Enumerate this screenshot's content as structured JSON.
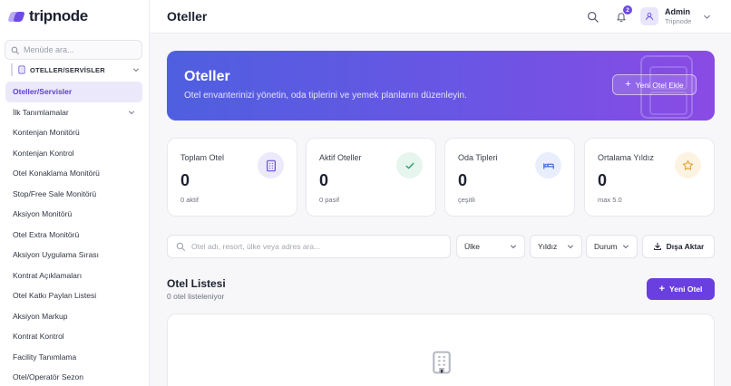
{
  "app": {
    "logo_text": "tripnode"
  },
  "sidebar": {
    "search_placeholder": "Menüde ara...",
    "section_label": "OTELLER/SERVİSLER",
    "items": [
      {
        "label": "Oteller/Servisler",
        "active": true
      },
      {
        "label": "İlk Tanımlamalar",
        "has_chevron": true
      },
      {
        "label": "Kontenjan Monitörü"
      },
      {
        "label": "Kontenjan Kontrol"
      },
      {
        "label": "Otel Konaklama Monitörü"
      },
      {
        "label": "Stop/Free Sale Monitörü"
      },
      {
        "label": "Aksiyon Monitörü"
      },
      {
        "label": "Otel Extra Monitörü"
      },
      {
        "label": "Aksiyon Uygulama Sırası"
      },
      {
        "label": "Kontrat Açıklamaları"
      },
      {
        "label": "Otel Katkı Paylan Listesi"
      },
      {
        "label": "Aksiyon Markup"
      },
      {
        "label": "Kontrat Kontrol"
      },
      {
        "label": "Facility Tanımlama"
      },
      {
        "label": "Otel/Operatör Sezon"
      }
    ]
  },
  "header": {
    "title": "Oteller",
    "notification_count": "2",
    "user": {
      "name": "Admin",
      "org": "Tripnode"
    }
  },
  "hero": {
    "title": "Oteller",
    "subtitle": "Otel envanterinizi yönetin, oda tiplerini ve yemek planlarını düzenleyin.",
    "button_label": "Yeni Otel Ekle"
  },
  "stats": [
    {
      "label": "Toplam Otel",
      "value": "0",
      "sub": "0 aktif",
      "icon": "building-icon",
      "icon_bg": "#ece9fb",
      "icon_color": "#6a4fe0"
    },
    {
      "label": "Aktif Oteller",
      "value": "0",
      "sub": "0 pasif",
      "icon": "check-icon",
      "icon_bg": "#e6f6ee",
      "icon_color": "#22a06b"
    },
    {
      "label": "Oda Tipleri",
      "value": "0",
      "sub": "çeşitli",
      "icon": "bed-icon",
      "icon_bg": "#e8eefc",
      "icon_color": "#4a6fe0"
    },
    {
      "label": "Ortalama Yıldız",
      "value": "0",
      "sub": "max 5.0",
      "icon": "star-icon",
      "icon_bg": "#fdf3e2",
      "icon_color": "#e0a030"
    }
  ],
  "filters": {
    "search_placeholder": "Otel adı, resort, ülke veya adres ara...",
    "country_label": "Ülke",
    "star_label": "Yıldız",
    "status_label": "Durum",
    "export_label": "Dışa Aktar"
  },
  "list": {
    "title": "Otel Listesi",
    "count_text": "0 otel listeleniyor",
    "new_button_label": "Yeni Otel"
  },
  "colors": {
    "accent": "#6a3fe0",
    "hero_start": "#4f5fe0",
    "hero_end": "#8a4be4"
  }
}
